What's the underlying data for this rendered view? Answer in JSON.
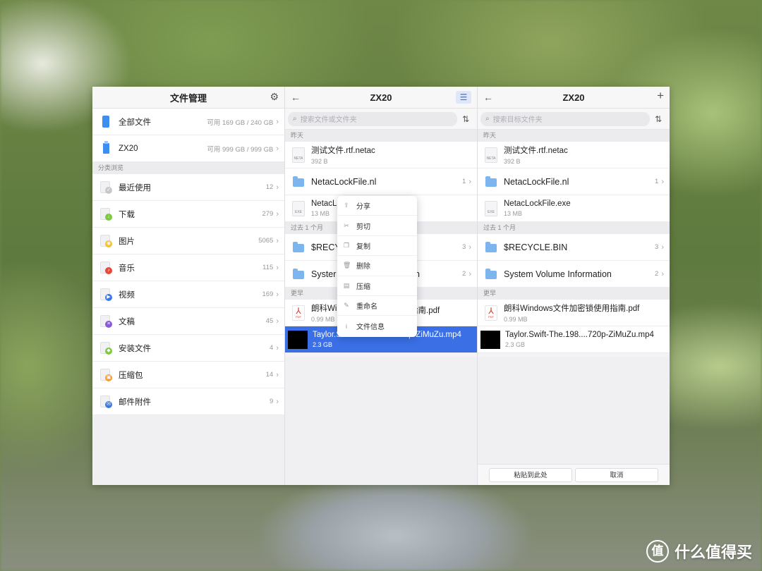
{
  "left_pane": {
    "title": "文件管理",
    "settings_icon": "gear-icon",
    "storage": [
      {
        "label": "全部文件",
        "info": "可用 169 GB / 240 GB"
      },
      {
        "label": "ZX20",
        "info": "可用 999 GB / 999 GB"
      }
    ],
    "category_header": "分类浏览",
    "categories": [
      {
        "label": "最近使用",
        "count": "12",
        "color": "#c8c8cc",
        "glyph": "✓"
      },
      {
        "label": "下载",
        "count": "279",
        "color": "#7ec842",
        "glyph": "↓"
      },
      {
        "label": "图片",
        "count": "5065",
        "color": "#f2c033",
        "glyph": "◉"
      },
      {
        "label": "音乐",
        "count": "115",
        "color": "#e8473a",
        "glyph": "♪"
      },
      {
        "label": "视频",
        "count": "169",
        "color": "#3d78e0",
        "glyph": "▶"
      },
      {
        "label": "文稿",
        "count": "45",
        "color": "#8a5ad8",
        "glyph": "≡"
      },
      {
        "label": "安装文件",
        "count": "4",
        "color": "#7ec842",
        "glyph": "◆"
      },
      {
        "label": "压缩包",
        "count": "14",
        "color": "#f29a33",
        "glyph": "▣"
      },
      {
        "label": "邮件附件",
        "count": "9",
        "color": "#3d78e0",
        "glyph": "✉"
      }
    ]
  },
  "middle_pane": {
    "title": "ZX20",
    "search_placeholder": "搜索文件或文件夹",
    "sections": [
      "昨天",
      "过去 1 个月",
      "更早"
    ],
    "files": [
      {
        "name": "测试文件.rtf.netac",
        "sub": "392 B",
        "type": "doc",
        "tag": "NETA"
      },
      {
        "name": "NetacLockFile.nl",
        "count": "1",
        "type": "folder"
      },
      {
        "name": "NetacL",
        "sub": "13 MB",
        "type": "doc",
        "tag": "EXE"
      },
      {
        "name": "$RECY",
        "count": "3",
        "type": "folder"
      },
      {
        "name": "Syster",
        "tail": "on",
        "count": "2",
        "type": "folder"
      },
      {
        "name": "朗科Wi",
        "tail": "指南.pdf",
        "sub": "0.99 MB",
        "type": "pdf"
      },
      {
        "name": "Taylor.Swift-The.198....720p-ZiMuZu.mp4",
        "sub": "2.3 GB",
        "type": "video"
      }
    ]
  },
  "context_menu": {
    "items": [
      {
        "label": "分享",
        "icon": "share-icon",
        "glyph": "⇪"
      },
      {
        "label": "剪切",
        "icon": "cut-icon",
        "glyph": "✂"
      },
      {
        "label": "复制",
        "icon": "copy-icon",
        "glyph": "❐"
      },
      {
        "label": "删除",
        "icon": "trash-icon",
        "glyph": "🗑"
      },
      {
        "label": "压缩",
        "icon": "compress-icon",
        "glyph": "▤"
      },
      {
        "label": "重命名",
        "icon": "pencil-icon",
        "glyph": "✎"
      },
      {
        "label": "文件信息",
        "icon": "info-icon",
        "glyph": "i"
      }
    ]
  },
  "right_pane": {
    "title": "ZX20",
    "search_placeholder": "搜索目标文件夹",
    "sections": [
      "昨天",
      "过去 1 个月",
      "更早"
    ],
    "files": [
      {
        "name": "测试文件.rtf.netac",
        "sub": "392 B",
        "type": "doc",
        "tag": "NETA"
      },
      {
        "name": "NetacLockFile.nl",
        "count": "1",
        "type": "folder"
      },
      {
        "name": "NetacLockFile.exe",
        "sub": "13 MB",
        "type": "doc",
        "tag": "EXE"
      },
      {
        "name": "$RECYCLE.BIN",
        "count": "3",
        "type": "folder"
      },
      {
        "name": "System Volume Information",
        "count": "2",
        "type": "folder"
      },
      {
        "name": "朗科Windows文件加密锁使用指南.pdf",
        "sub": "0.99 MB",
        "type": "pdf"
      },
      {
        "name": "Taylor.Swift-The.198....720p-ZiMuZu.mp4",
        "sub": "2.3 GB",
        "type": "video"
      }
    ],
    "paste_label": "粘贴到此处",
    "cancel_label": "取消"
  },
  "watermark": {
    "logo": "值",
    "text": "什么值得买"
  },
  "colors": {
    "accent": "#3a6fe6",
    "folder": "#7db6ef",
    "pdf_red": "#d9342b"
  }
}
